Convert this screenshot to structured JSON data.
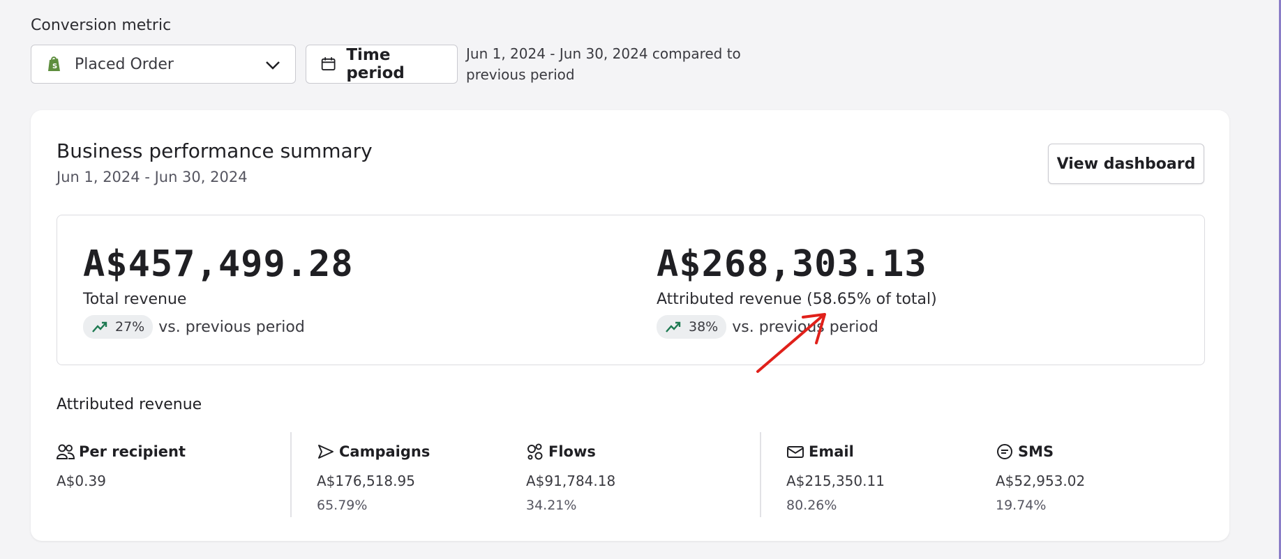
{
  "conversion": {
    "label": "Conversion metric",
    "selected": "Placed Order",
    "time_button": "Time period",
    "period_text": "Jun 1, 2024 - Jun 30, 2024 compared to previous period"
  },
  "summary": {
    "title": "Business performance summary",
    "date_range": "Jun 1, 2024 - Jun 30, 2024",
    "dashboard_button": "View dashboard",
    "total": {
      "value": "A$457,499.28",
      "label": "Total revenue",
      "change": "27%",
      "vs": "vs. previous period"
    },
    "attributed": {
      "value": "A$268,303.13",
      "label": "Attributed revenue (58.65% of total)",
      "change": "38%",
      "vs": "vs. previous period"
    }
  },
  "attributed_breakdown": {
    "title": "Attributed revenue",
    "stats": [
      {
        "icon": "people-icon",
        "label": "Per recipient",
        "value": "A$0.39",
        "pct": ""
      },
      {
        "icon": "send-icon",
        "label": "Campaigns",
        "value": "A$176,518.95",
        "pct": "65.79%"
      },
      {
        "icon": "flows-icon",
        "label": "Flows",
        "value": "A$91,784.18",
        "pct": "34.21%"
      },
      {
        "icon": "mail-icon",
        "label": "Email",
        "value": "A$215,350.11",
        "pct": "80.26%"
      },
      {
        "icon": "chat-icon",
        "label": "SMS",
        "value": "A$52,953.02",
        "pct": "19.74%"
      }
    ]
  },
  "colors": {
    "trend_green": "#1e7a52",
    "annotation_red": "#e0201a",
    "shopify_green": "#5e8e3e"
  }
}
